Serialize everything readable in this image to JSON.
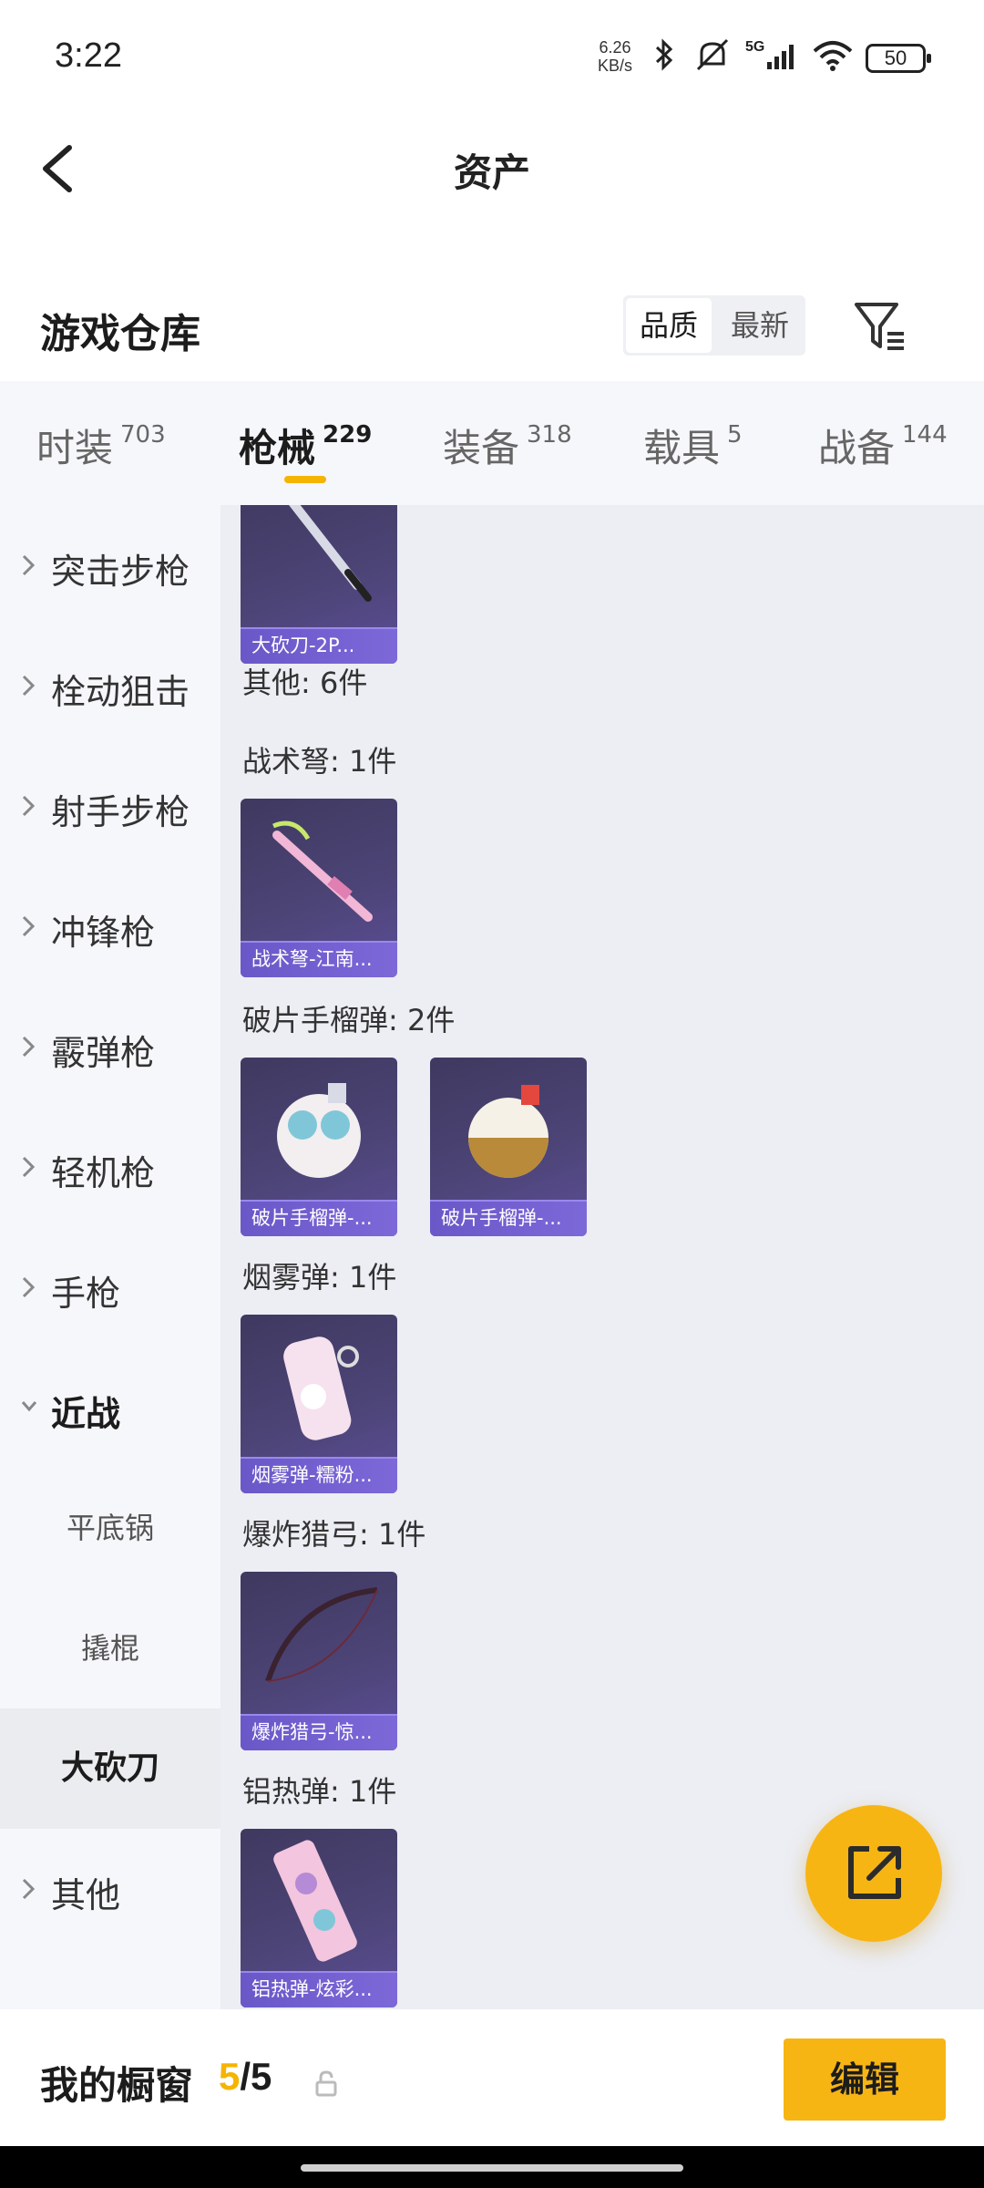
{
  "status_bar": {
    "time": "3:22",
    "net_speed_value": "6.26",
    "net_speed_unit": "KB/s",
    "signal_label": "5G",
    "battery": "50"
  },
  "header": {
    "title": "资产"
  },
  "store": {
    "title": "游戏仓库",
    "sort_options": [
      "品质",
      "最新"
    ],
    "active_sort": "品质"
  },
  "tabs": [
    {
      "label": "时装",
      "count": "703",
      "active": false
    },
    {
      "label": "枪械",
      "count": "229",
      "active": true
    },
    {
      "label": "装备",
      "count": "318",
      "active": false
    },
    {
      "label": "载具",
      "count": "5",
      "active": false
    },
    {
      "label": "战备",
      "count": "144",
      "active": false
    }
  ],
  "sidebar": {
    "categories": [
      {
        "label": "突击步枪",
        "expanded": false
      },
      {
        "label": "栓动狙击",
        "expanded": false
      },
      {
        "label": "射手步枪",
        "expanded": false
      },
      {
        "label": "冲锋枪",
        "expanded": false
      },
      {
        "label": "霰弹枪",
        "expanded": false
      },
      {
        "label": "轻机枪",
        "expanded": false
      },
      {
        "label": "手枪",
        "expanded": false
      },
      {
        "label": "近战",
        "expanded": true
      }
    ],
    "subcategories": [
      {
        "label": "平底锅",
        "selected": false
      },
      {
        "label": "撬棍",
        "selected": false
      },
      {
        "label": "大砍刀",
        "selected": true
      }
    ],
    "after": {
      "label": "其他",
      "expanded": false
    }
  },
  "content": {
    "top_card_caption": "大砍刀-2P...",
    "other_label": "其他: 6件",
    "groups": [
      {
        "label": "战术弩: 1件",
        "items": [
          "战术弩-江南..."
        ]
      },
      {
        "label": "破片手榴弹: 2件",
        "items": [
          "破片手榴弹-...",
          "破片手榴弹-..."
        ]
      },
      {
        "label": "烟雾弹: 1件",
        "items": [
          "烟雾弹-糯粉..."
        ]
      },
      {
        "label": "爆炸猎弓: 1件",
        "items": [
          "爆炸猎弓-惊..."
        ]
      },
      {
        "label": "铝热弹: 1件",
        "items": [
          "铝热弹-炫彩..."
        ]
      }
    ]
  },
  "bottom_bar": {
    "label": "我的橱窗",
    "current": "5",
    "total": "5",
    "edit_label": "编辑"
  },
  "colors": {
    "accent": "#f7b514",
    "card_caption": "#6a58c8",
    "card_bg": "#4c4476"
  }
}
